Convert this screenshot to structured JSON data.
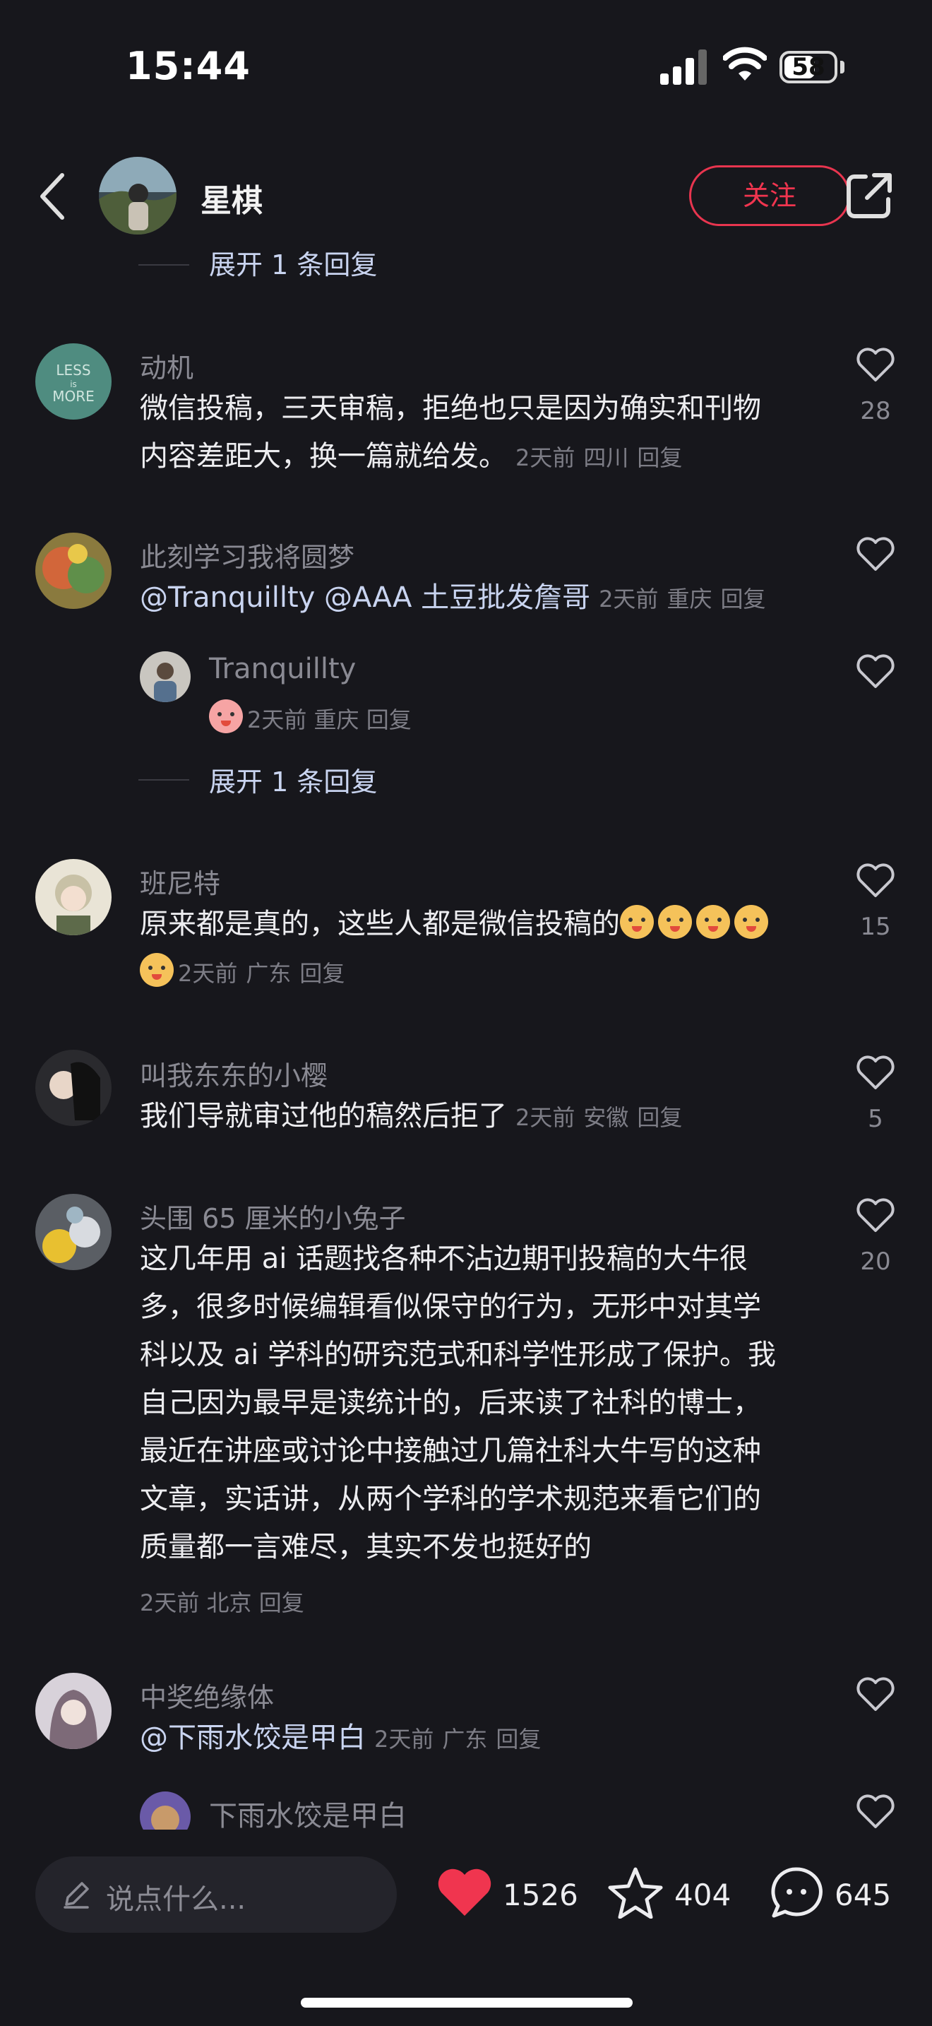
{
  "status": {
    "time": "15:44",
    "battery": "58",
    "battery_level": 0.58
  },
  "header": {
    "name": "星棋",
    "follow_label": "关注"
  },
  "feed": {
    "top_expand": "展开 1 条回复",
    "comments": [
      {
        "user": "动机",
        "avatar_text": "LESS IS MORE",
        "lines": [
          "微信投稿，三天审稿，拒绝也只是因为确实和刊物",
          "内容差距大，换一篇就给发。"
        ],
        "time": "2天前",
        "loc": "四川",
        "reply": "回复",
        "likes": "28"
      },
      {
        "user": "此刻学习我将圆梦",
        "mention1": "@Tranquillty",
        "mention2": "@AAA 土豆批发詹哥",
        "time": "2天前",
        "loc": "重庆",
        "reply": "回复",
        "likes": "",
        "sub": {
          "user": "Tranquillty",
          "time": "2天前",
          "loc": "重庆",
          "reply": "回复"
        },
        "expand": "展开 1 条回复"
      },
      {
        "user": "班尼特",
        "text": "原来都是真的，这些人都是微信投稿的",
        "time": "2天前",
        "loc": "广东",
        "reply": "回复",
        "likes": "15"
      },
      {
        "user": "叫我东东的小樱",
        "text": "我们导就审过他的稿然后拒了",
        "time": "2天前",
        "loc": "安徽",
        "reply": "回复",
        "likes": "5"
      },
      {
        "user": "头围 65 厘米的小兔子",
        "lines": [
          "这几年用 ai 话题找各种不沾边期刊投稿的大牛很",
          "多，很多时候编辑看似保守的行为，无形中对其学",
          "科以及 ai 学科的研究范式和科学性形成了保护。我",
          "自己因为最早是读统计的，后来读了社科的博士，",
          "最近在讲座或讨论中接触过几篇社科大牛写的这种",
          "文章，实话讲，从两个学科的学术规范来看它们的",
          "质量都一言难尽，其实不发也挺好的"
        ],
        "time": "2天前",
        "loc": "北京",
        "reply": "回复",
        "likes": "20"
      },
      {
        "user": "中奖绝缘体",
        "mention": "@下雨水饺是甲白",
        "time": "2天前",
        "loc": "广东",
        "reply": "回复",
        "likes": "",
        "sub": {
          "user": "下雨水饺是甲白"
        }
      }
    ]
  },
  "bottom": {
    "placeholder": "说点什么...",
    "likes": "1526",
    "stars": "404",
    "comments": "645"
  },
  "colors": {
    "background": "#17171c",
    "accent": "#f0354f",
    "mention": "#c9d4f0"
  }
}
